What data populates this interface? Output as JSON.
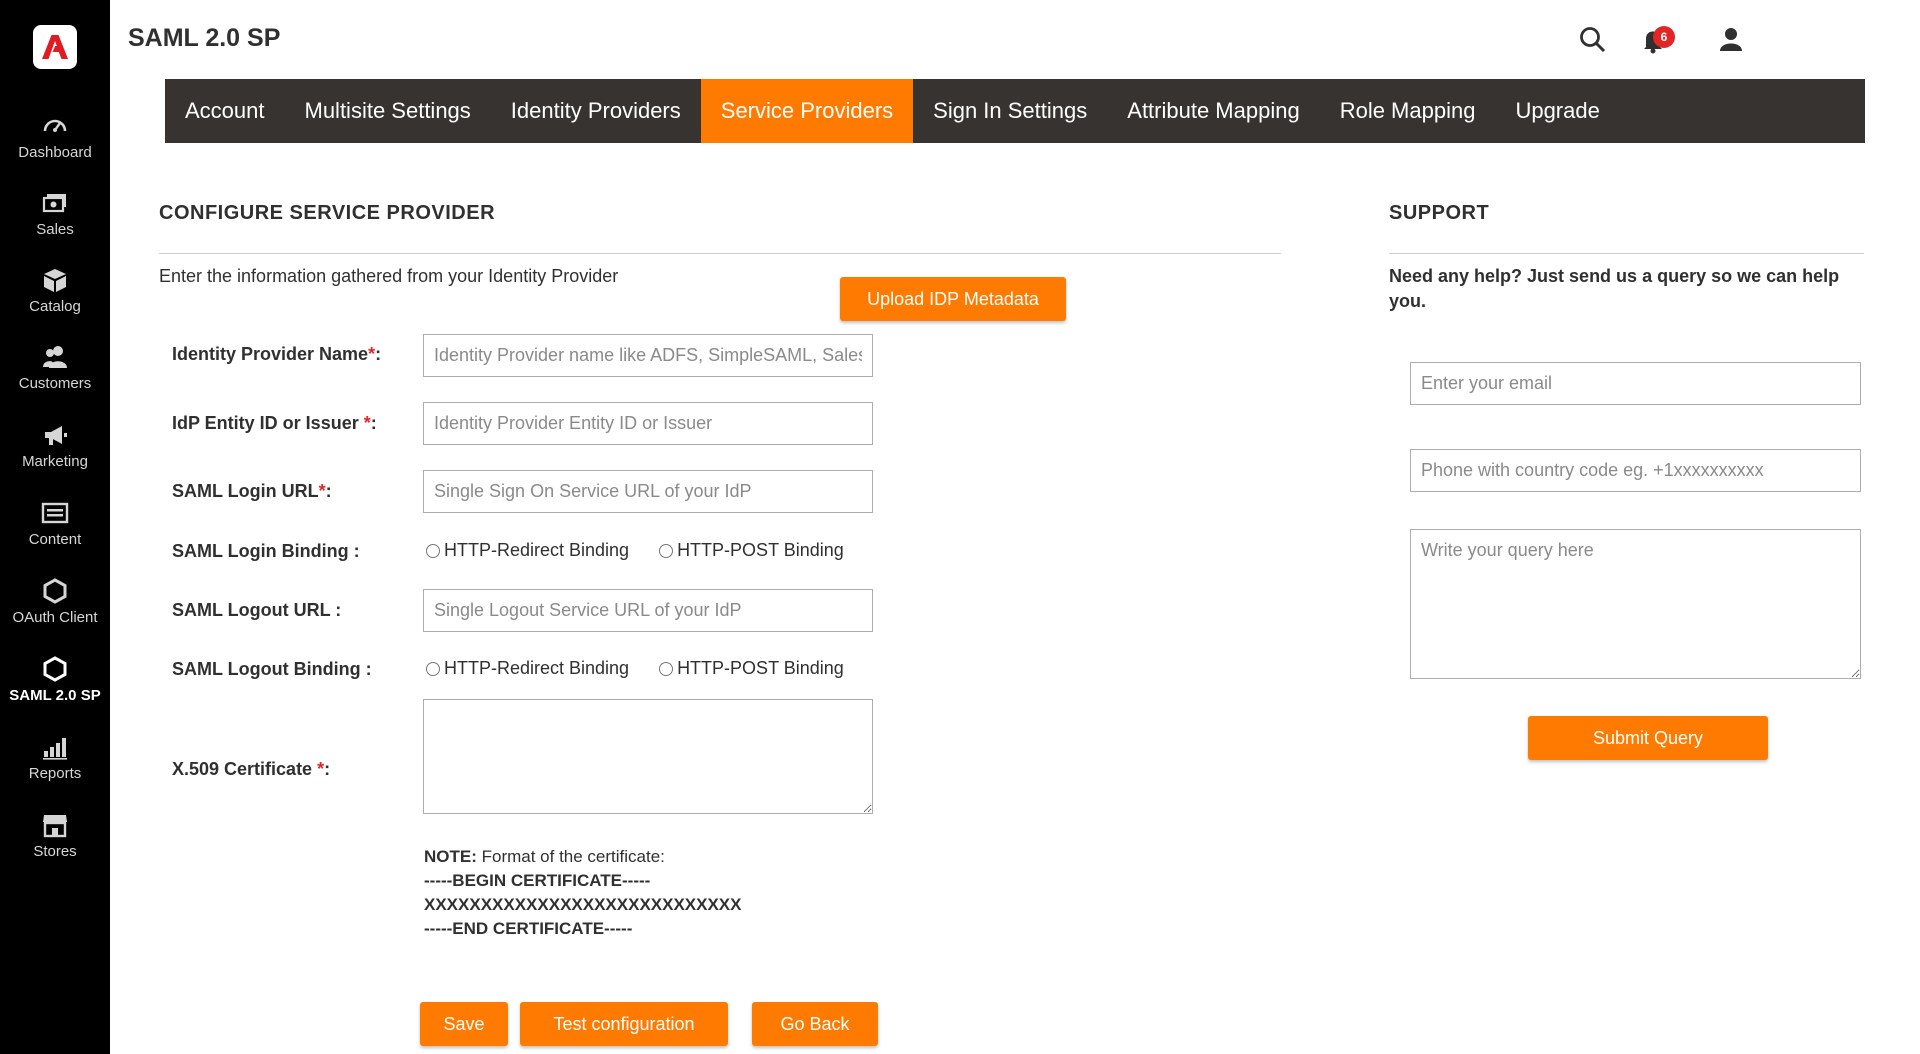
{
  "sidebar": {
    "items": [
      {
        "label": "Dashboard",
        "icon": "dashboard-icon"
      },
      {
        "label": "Sales",
        "icon": "sales-icon"
      },
      {
        "label": "Catalog",
        "icon": "catalog-icon"
      },
      {
        "label": "Customers",
        "icon": "customers-icon"
      },
      {
        "label": "Marketing",
        "icon": "marketing-icon"
      },
      {
        "label": "Content",
        "icon": "content-icon"
      },
      {
        "label": "OAuth Client",
        "icon": "hexagon-icon"
      },
      {
        "label": "SAML 2.0 SP",
        "icon": "hexagon-icon",
        "active": true
      },
      {
        "label": "Reports",
        "icon": "reports-icon"
      },
      {
        "label": "Stores",
        "icon": "stores-icon"
      }
    ]
  },
  "header": {
    "title": "SAML 2.0 SP",
    "notification_count": "6"
  },
  "tabs": [
    {
      "label": "Account"
    },
    {
      "label": "Multisite Settings"
    },
    {
      "label": "Identity Providers"
    },
    {
      "label": "Service Providers",
      "active": true
    },
    {
      "label": "Sign In Settings"
    },
    {
      "label": "Attribute Mapping"
    },
    {
      "label": "Role Mapping"
    },
    {
      "label": "Upgrade"
    }
  ],
  "configure": {
    "heading": "CONFIGURE SERVICE PROVIDER",
    "intro": "Enter the information gathered from your Identity Provider",
    "upload_button": "Upload IDP Metadata",
    "fields": {
      "idp_name": {
        "label": "Identity Provider Name",
        "suffix": ":",
        "placeholder": "Identity Provider name like ADFS, SimpleSAML, Salesforce"
      },
      "entity_id": {
        "label": "IdP Entity ID or Issuer ",
        "suffix": ":",
        "placeholder": "Identity Provider Entity ID or Issuer"
      },
      "login_url": {
        "label": "SAML Login URL",
        "suffix": ":",
        "placeholder": "Single Sign On Service URL of your IdP"
      },
      "login_binding": {
        "label": "SAML Login Binding :"
      },
      "logout_url": {
        "label": "SAML Logout URL :",
        "placeholder": "Single Logout Service URL of your IdP"
      },
      "logout_binding": {
        "label": "SAML Logout Binding :"
      },
      "certificate": {
        "label": "X.509 Certificate ",
        "suffix": ":"
      }
    },
    "binding_options": {
      "redirect": "HTTP-Redirect Binding",
      "post": "HTTP-POST Binding"
    },
    "required_mark": "*",
    "note": {
      "label": "NOTE:",
      "text": " Format of the certificate:",
      "begin": "-----BEGIN CERTIFICATE-----",
      "body": "XXXXXXXXXXXXXXXXXXXXXXXXXXXX",
      "end": "-----END CERTIFICATE-----"
    },
    "buttons": {
      "save": "Save",
      "test": "Test configuration",
      "back": "Go Back"
    }
  },
  "support": {
    "heading": "SUPPORT",
    "text": "Need any help? Just send us a query so we can help you.",
    "email_placeholder": "Enter your email",
    "phone_placeholder": "Phone with country code eg. +1xxxxxxxxxx",
    "query_placeholder": "Write your query here",
    "submit": "Submit Query"
  },
  "colors": {
    "accent": "#ff7a00",
    "tabbar": "#373330",
    "sidebar": "#000000",
    "required": "#e22626",
    "logo": "#e11b22"
  }
}
